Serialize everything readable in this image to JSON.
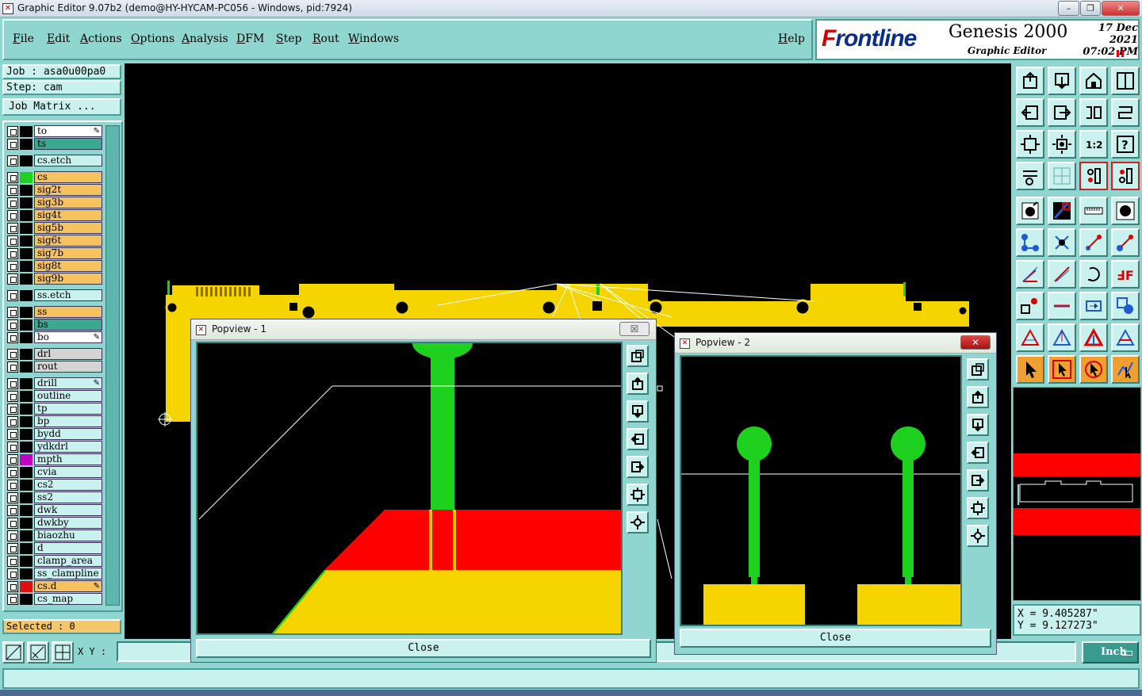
{
  "window": {
    "title": "Graphic Editor 9.07b2 (demo@HY-HYCAM-PC056 - Windows, pid:7924)",
    "minimize": "–",
    "maximize": "❐",
    "close": "✕"
  },
  "menu": [
    "File",
    "Edit",
    "Actions",
    "Options",
    "Analysis",
    "DFM",
    "Step",
    "Rout",
    "Windows"
  ],
  "help": "Help",
  "logo": {
    "brand_prefix": "F",
    "brand_rest": "rontline",
    "product": "Genesis 2000",
    "subtitle": "Graphic Editor",
    "date_line1": "17 Dec 2021",
    "date_line2": "07:02 PM"
  },
  "job": {
    "job_label": "Job : asa0u00pa0",
    "step_label": "Step: cam",
    "matrix_button": "Job Matrix ..."
  },
  "layers": [
    {
      "name": "to",
      "color": "#ffffff",
      "swatch": "#000000",
      "editable": true
    },
    {
      "name": "ts",
      "color": "#3aa98f",
      "swatch": "#000000",
      "editable": false
    },
    {
      "name": "cs.etch",
      "color": "#c9f2ee",
      "swatch": "#000000",
      "editable": false
    },
    {
      "name": "cs",
      "color": "#f6c260",
      "swatch": "#1fd11f",
      "editable": false
    },
    {
      "name": "sig2t",
      "color": "#f6c260",
      "swatch": "#000000",
      "editable": false
    },
    {
      "name": "sig3b",
      "color": "#f6c260",
      "swatch": "#000000",
      "editable": false
    },
    {
      "name": "sig4t",
      "color": "#f6c260",
      "swatch": "#000000",
      "editable": false
    },
    {
      "name": "sig5b",
      "color": "#f6c260",
      "swatch": "#000000",
      "editable": false
    },
    {
      "name": "sig6t",
      "color": "#f6c260",
      "swatch": "#000000",
      "editable": false
    },
    {
      "name": "sig7b",
      "color": "#f6c260",
      "swatch": "#000000",
      "editable": false
    },
    {
      "name": "sig8t",
      "color": "#f6c260",
      "swatch": "#000000",
      "editable": false
    },
    {
      "name": "sig9b",
      "color": "#f6c260",
      "swatch": "#000000",
      "editable": false
    },
    {
      "name": "ss.etch",
      "color": "#c9f2ee",
      "swatch": "#000000",
      "editable": false
    },
    {
      "name": "ss",
      "color": "#f6c260",
      "swatch": "#000000",
      "editable": false
    },
    {
      "name": "bs",
      "color": "#3aa98f",
      "swatch": "#000000",
      "editable": false
    },
    {
      "name": "bo",
      "color": "#ffffff",
      "swatch": "#000000",
      "editable": true
    },
    {
      "name": "drl",
      "color": "#d4d4d4",
      "swatch": "#000000",
      "editable": false
    },
    {
      "name": "rout",
      "color": "#d4d4d4",
      "swatch": "#000000",
      "editable": false
    },
    {
      "name": "drill",
      "color": "#c9f2ee",
      "swatch": "#000000",
      "editable": true
    },
    {
      "name": "outline",
      "color": "#c9f2ee",
      "swatch": "#000000",
      "editable": false
    },
    {
      "name": "tp",
      "color": "#c9f2ee",
      "swatch": "#000000",
      "editable": false
    },
    {
      "name": "bp",
      "color": "#c9f2ee",
      "swatch": "#000000",
      "editable": false
    },
    {
      "name": "bydd",
      "color": "#c9f2ee",
      "swatch": "#000000",
      "editable": false
    },
    {
      "name": "ydkdrl",
      "color": "#c9f2ee",
      "swatch": "#000000",
      "editable": false
    },
    {
      "name": "mpth",
      "color": "#c9f2ee",
      "swatch": "#c000c0",
      "editable": false
    },
    {
      "name": "cvia",
      "color": "#c9f2ee",
      "swatch": "#000000",
      "editable": false
    },
    {
      "name": "cs2",
      "color": "#c9f2ee",
      "swatch": "#000000",
      "editable": false
    },
    {
      "name": "ss2",
      "color": "#c9f2ee",
      "swatch": "#000000",
      "editable": false
    },
    {
      "name": "dwk",
      "color": "#c9f2ee",
      "swatch": "#000000",
      "editable": false
    },
    {
      "name": "dwkby",
      "color": "#c9f2ee",
      "swatch": "#000000",
      "editable": false
    },
    {
      "name": "biaozhu",
      "color": "#c9f2ee",
      "swatch": "#000000",
      "editable": false
    },
    {
      "name": "d",
      "color": "#c9f2ee",
      "swatch": "#000000",
      "editable": false
    },
    {
      "name": "clamp_area",
      "color": "#c9f2ee",
      "swatch": "#000000",
      "editable": false
    },
    {
      "name": "ss_clampline",
      "color": "#c9f2ee",
      "swatch": "#000000",
      "editable": false
    },
    {
      "name": "cs.d",
      "color": "#f6c260",
      "swatch": "#e01010",
      "editable": true
    },
    {
      "name": "cs_map",
      "color": "#c9f2ee",
      "swatch": "#000000",
      "editable": false
    }
  ],
  "selected": "Selected : 0",
  "xy_label": "X Y :",
  "xy_value": "",
  "units": "Inch",
  "coords": {
    "x": "X = 9.405287\"",
    "y": "Y = 9.127273\""
  },
  "popup1": {
    "title": "Popview - 1",
    "close_label": "Close",
    "x_icon": "☒"
  },
  "popup2": {
    "title": "Popview - 2",
    "close_label": "Close",
    "x_icon": "✕"
  },
  "colors": {
    "bg": "#8ed6cf",
    "board_yellow": "#f5d400",
    "trace_green": "#1fd11f",
    "mask_red": "#ff0000"
  }
}
